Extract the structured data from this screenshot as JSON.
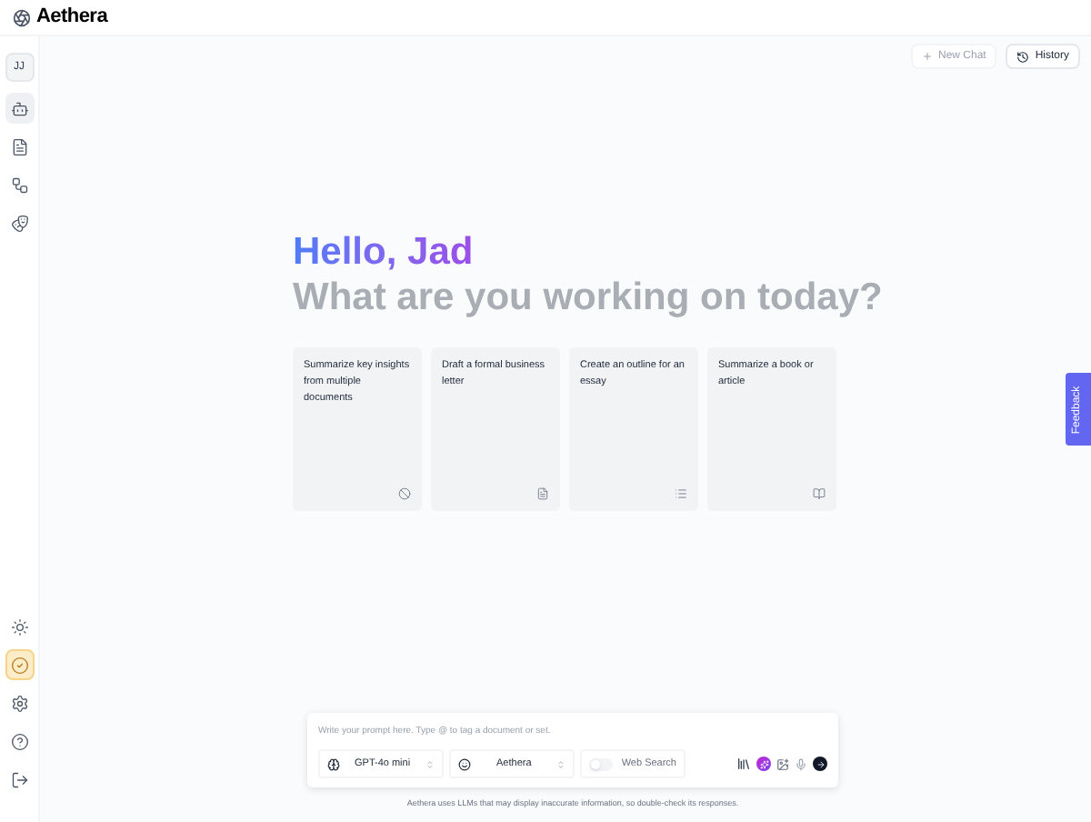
{
  "app": {
    "name": "Aethera"
  },
  "sidebar": {
    "avatar": "JJ",
    "top_items": [
      {
        "kind": "bot",
        "selected": true
      },
      {
        "kind": "document",
        "selected": false
      },
      {
        "kind": "workflow",
        "selected": false
      },
      {
        "kind": "mask",
        "selected": false
      }
    ],
    "bottom_items": [
      {
        "kind": "theme",
        "selected": false
      },
      {
        "kind": "tasks",
        "selected": true
      },
      {
        "kind": "settings",
        "selected": false
      },
      {
        "kind": "help",
        "selected": false
      },
      {
        "kind": "logout",
        "selected": false
      }
    ]
  },
  "toolbar": {
    "new_chat": "New Chat",
    "history": "History"
  },
  "greeting": {
    "hello": "Hello, Jad",
    "question": "What are you working on today?"
  },
  "suggestions": [
    {
      "text": "Summarize key insights from multiple documents",
      "kind": "blocked"
    },
    {
      "text": "Draft a formal business letter",
      "kind": "document"
    },
    {
      "text": "Create an outline for an essay",
      "kind": "list"
    },
    {
      "text": "Summarize a book or article",
      "kind": "book"
    }
  ],
  "composer": {
    "placeholder": "Write your prompt here. Type @ to tag a document or set.",
    "model": "GPT-4o mini",
    "assistant": "Aethera",
    "web_search": {
      "label": "Web Search",
      "on": false
    }
  },
  "disclaimer": "Aethera uses LLMs that may display inaccurate information, so double-check its responses.",
  "feedback": "Feedback"
}
